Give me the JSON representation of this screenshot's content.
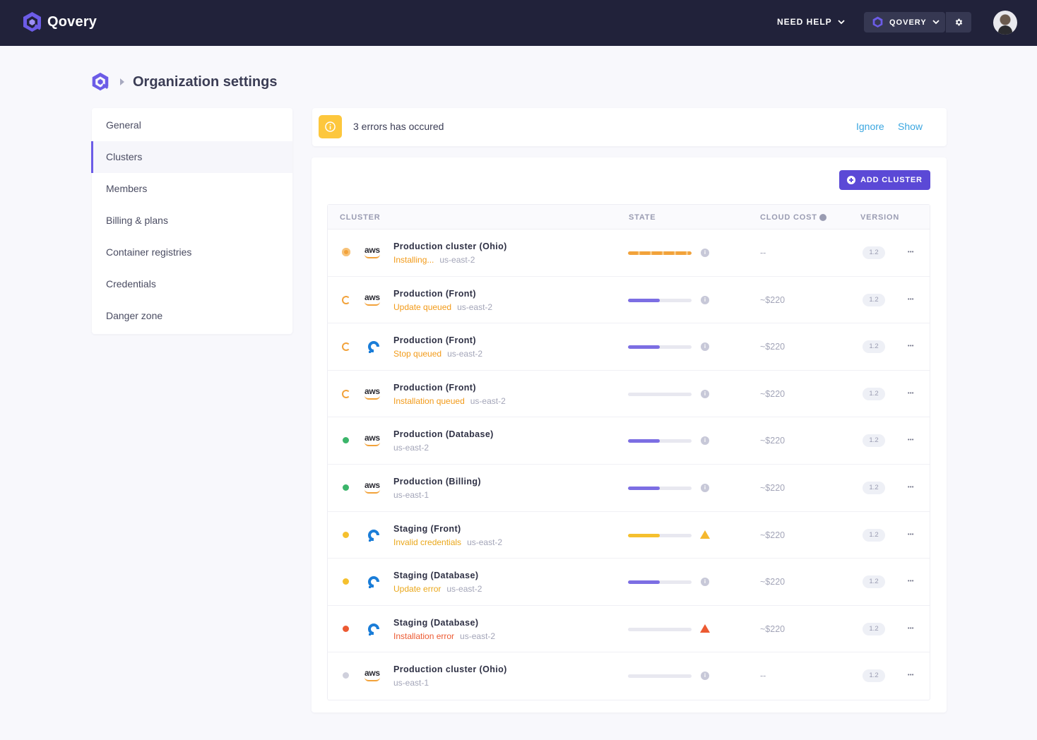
{
  "topbar": {
    "brand": "Qovery",
    "help_label": "NEED HELP",
    "org_label": "QOVERY"
  },
  "breadcrumb": {
    "title": "Organization settings"
  },
  "sidebar": {
    "items": [
      {
        "label": "General",
        "active": false
      },
      {
        "label": "Clusters",
        "active": true
      },
      {
        "label": "Members",
        "active": false
      },
      {
        "label": "Billing & plans",
        "active": false
      },
      {
        "label": "Container registries",
        "active": false
      },
      {
        "label": "Credentials",
        "active": false
      },
      {
        "label": "Danger zone",
        "active": false
      }
    ]
  },
  "alert": {
    "icon": "info-icon",
    "message": "3 errors has occured",
    "ignore_label": "Ignore",
    "show_label": "Show"
  },
  "toolbar": {
    "add_label": "ADD CLUSTER"
  },
  "table": {
    "headers": {
      "cluster": "CLUSTER",
      "state": "STATE",
      "cost": "CLOUD COST",
      "version": "VERSION"
    },
    "rows": [
      {
        "status": "installing",
        "provider": "aws",
        "name": "Production cluster (Ohio)",
        "message": "Installing...",
        "region": "us-east-2",
        "progress": 1.0,
        "bar_style": "installing",
        "indicator": "info",
        "cost": "--",
        "version": "1.2"
      },
      {
        "status": "queued",
        "provider": "aws",
        "name": "Production (Front)",
        "message": "Update queued",
        "region": "us-east-2",
        "progress": 0.5,
        "bar_style": "purple",
        "indicator": "info",
        "cost": "~$220",
        "version": "1.2"
      },
      {
        "status": "queued",
        "provider": "digitalocean",
        "name": "Production (Front)",
        "message": "Stop queued",
        "region": "us-east-2",
        "progress": 0.5,
        "bar_style": "purple",
        "indicator": "info",
        "cost": "~$220",
        "version": "1.2"
      },
      {
        "status": "queued",
        "provider": "aws",
        "name": "Production (Front)",
        "message": "Installation queued",
        "region": "us-east-2",
        "progress": 0,
        "bar_style": "purple",
        "indicator": "info",
        "cost": "~$220",
        "version": "1.2"
      },
      {
        "status": "running",
        "provider": "aws",
        "name": "Production (Database)",
        "message": "",
        "region": "us-east-2",
        "progress": 0.5,
        "bar_style": "purple",
        "indicator": "info",
        "cost": "~$220",
        "version": "1.2"
      },
      {
        "status": "running",
        "provider": "aws",
        "name": "Production (Billing)",
        "message": "",
        "region": "us-east-1",
        "progress": 0.5,
        "bar_style": "purple",
        "indicator": "info",
        "cost": "~$220",
        "version": "1.2"
      },
      {
        "status": "warning",
        "provider": "digitalocean",
        "name": "Staging (Front)",
        "message": "Invalid credentials",
        "region": "us-east-2",
        "progress": 0.5,
        "bar_style": "yellow",
        "indicator": "warning",
        "cost": "~$220",
        "version": "1.2"
      },
      {
        "status": "warning",
        "provider": "digitalocean",
        "name": "Staging (Database)",
        "message": "Update error",
        "region": "us-east-2",
        "progress": 0.5,
        "bar_style": "purple",
        "indicator": "info",
        "cost": "~$220",
        "version": "1.2"
      },
      {
        "status": "error",
        "provider": "digitalocean",
        "name": "Staging (Database)",
        "message": "Installation error",
        "region": "us-east-2",
        "progress": 0,
        "bar_style": "purple",
        "indicator": "error",
        "cost": "~$220",
        "version": "1.2"
      },
      {
        "status": "stopped",
        "provider": "aws",
        "name": "Production cluster (Ohio)",
        "message": "",
        "region": "us-east-1",
        "progress": 0,
        "bar_style": "purple",
        "indicator": "info",
        "cost": "--",
        "version": "1.2"
      }
    ]
  },
  "colors": {
    "accent": "#5b49d6",
    "topbar": "#21223a",
    "orange": "#f29a18",
    "green": "#3bb56a",
    "yellow": "#f5c02e",
    "red": "#ec5a32",
    "grey": "#cfd0dc",
    "link": "#3aa6e0"
  }
}
